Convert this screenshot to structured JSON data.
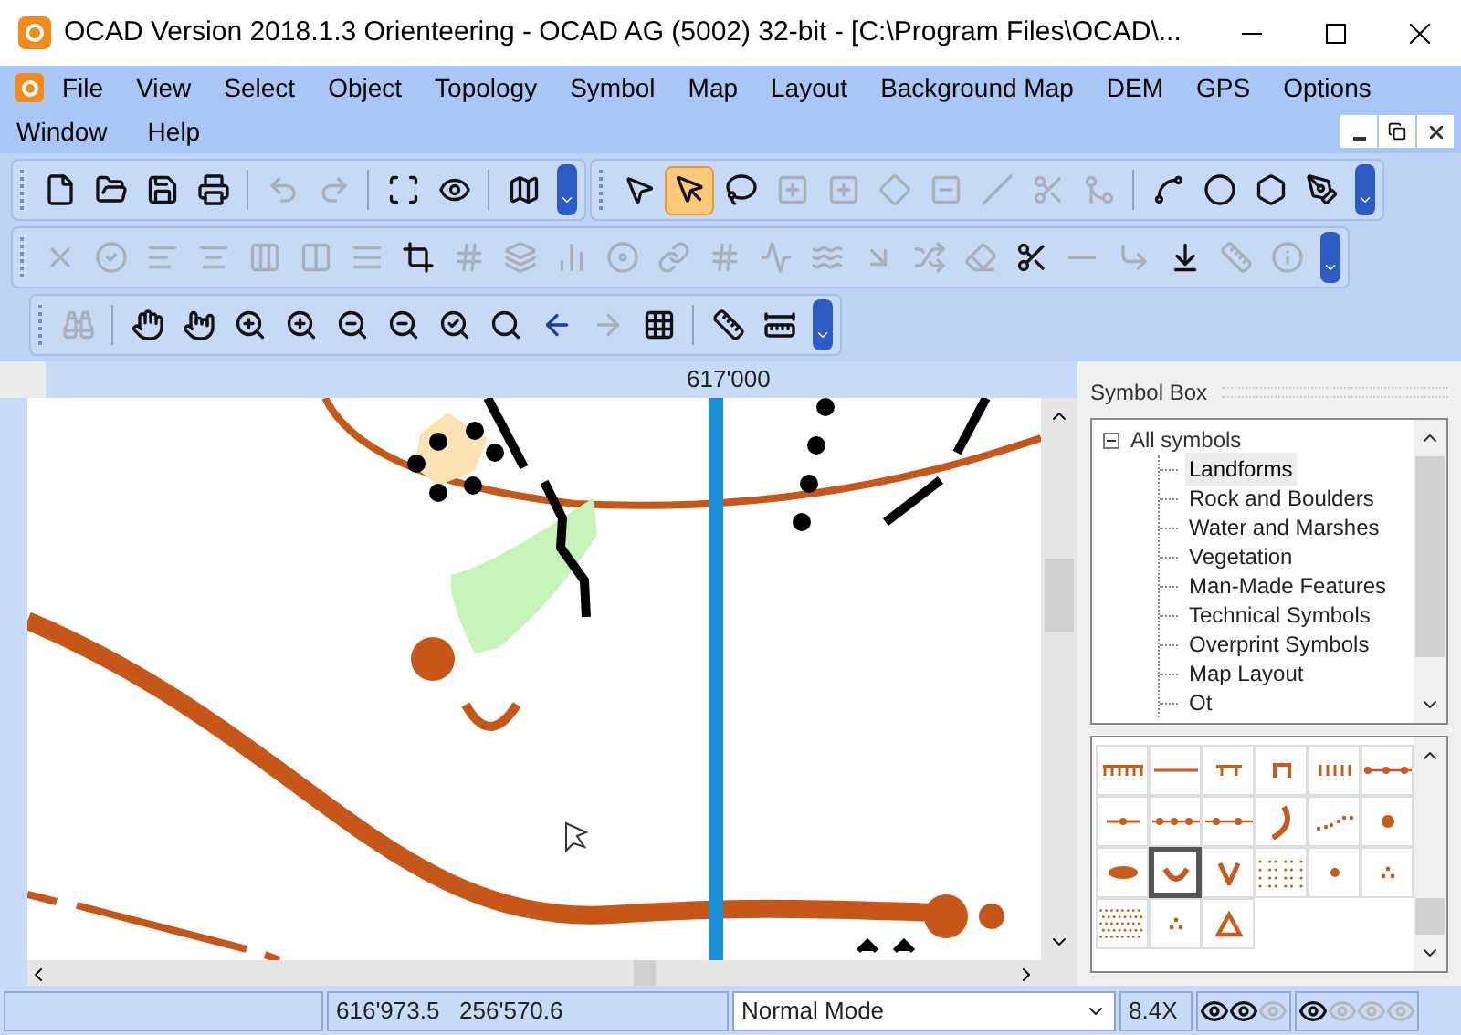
{
  "window": {
    "title": "OCAD Version 2018.1.3  Orienteering - OCAD AG (5002) 32-bit - [C:\\Program Files\\OCAD\\..."
  },
  "menu": [
    {
      "label": "File"
    },
    {
      "label": "View"
    },
    {
      "label": "Select"
    },
    {
      "label": "Object"
    },
    {
      "label": "Topology"
    },
    {
      "label": "Symbol"
    },
    {
      "label": "Map"
    },
    {
      "label": "Layout"
    },
    {
      "label": "Background Map"
    },
    {
      "label": "DEM"
    },
    {
      "label": "GPS"
    },
    {
      "label": "Options"
    },
    {
      "label": "Window"
    },
    {
      "label": "Help"
    }
  ],
  "toolbars": [
    {
      "groups": [
        [
          {
            "disabled": false,
            "selected": false
          },
          {
            "disabled": false,
            "selected": false
          },
          {
            "disabled": false,
            "selected": false
          },
          {
            "disabled": false,
            "selected": false
          }
        ],
        [
          {
            "disabled": true,
            "selected": false
          },
          {
            "disabled": true,
            "selected": false
          }
        ],
        [
          {
            "disabled": false,
            "selected": false
          },
          {
            "disabled": false,
            "selected": false
          }
        ],
        [
          {
            "disabled": false,
            "selected": false
          }
        ]
      ]
    },
    {
      "groups": [
        [
          {
            "disabled": false,
            "selected": false
          },
          {
            "disabled": false,
            "selected": true
          },
          {
            "disabled": false,
            "selected": false
          },
          {
            "disabled": true,
            "selected": false
          },
          {
            "disabled": true,
            "selected": false
          },
          {
            "disabled": true,
            "selected": false
          },
          {
            "disabled": true,
            "selected": false
          },
          {
            "disabled": true,
            "selected": false
          },
          {
            "disabled": true,
            "selected": false
          },
          {
            "disabled": true,
            "selected": false
          }
        ],
        [
          {
            "disabled": false,
            "selected": false
          },
          {
            "disabled": false,
            "selected": false
          },
          {
            "disabled": false,
            "selected": false
          },
          {
            "disabled": false,
            "selected": false
          }
        ]
      ]
    },
    {
      "groups": [
        [
          {
            "disabled": true,
            "selected": false
          },
          {
            "disabled": true,
            "selected": false
          },
          {
            "disabled": true,
            "selected": false
          },
          {
            "disabled": true,
            "selected": false
          },
          {
            "disabled": true,
            "selected": false
          },
          {
            "disabled": true,
            "selected": false
          },
          {
            "disabled": true,
            "selected": false
          },
          {
            "disabled": false,
            "selected": false
          },
          {
            "disabled": true,
            "selected": false
          },
          {
            "disabled": true,
            "selected": false
          },
          {
            "disabled": true,
            "selected": false
          },
          {
            "disabled": true,
            "selected": false
          },
          {
            "disabled": true,
            "selected": false
          },
          {
            "disabled": true,
            "selected": false
          },
          {
            "disabled": true,
            "selected": false
          },
          {
            "disabled": true,
            "selected": false
          },
          {
            "disabled": true,
            "selected": false
          },
          {
            "disabled": true,
            "selected": false
          },
          {
            "disabled": true,
            "selected": false
          },
          {
            "disabled": false,
            "selected": false
          },
          {
            "disabled": true,
            "selected": false
          },
          {
            "disabled": true,
            "selected": false
          },
          {
            "disabled": false,
            "selected": false
          },
          {
            "disabled": true,
            "selected": false
          },
          {
            "disabled": true,
            "selected": false
          }
        ]
      ]
    },
    {
      "groups": [
        [
          {
            "disabled": true,
            "selected": false
          }
        ],
        [
          {
            "disabled": false,
            "selected": false
          },
          {
            "disabled": false,
            "selected": false
          },
          {
            "disabled": false,
            "selected": false
          },
          {
            "disabled": false,
            "selected": false
          },
          {
            "disabled": false,
            "selected": false
          },
          {
            "disabled": false,
            "selected": false
          },
          {
            "disabled": false,
            "selected": false
          },
          {
            "disabled": false,
            "selected": false
          },
          {
            "disabled": false,
            "selected": false
          },
          {
            "disabled": true,
            "selected": false
          },
          {
            "disabled": false,
            "selected": false
          }
        ],
        [
          {
            "disabled": false,
            "selected": false
          },
          {
            "disabled": false,
            "selected": false
          }
        ]
      ]
    }
  ],
  "ruler": {
    "label": "617'000"
  },
  "symbol_box": {
    "title": "Symbol Box",
    "tree": [
      {
        "label": "All symbols",
        "expanded": true,
        "selected": false,
        "children": [
          {
            "label": "Landforms",
            "selected": true
          },
          {
            "label": "Rock and Boulders",
            "selected": false
          },
          {
            "label": "Water and Marshes",
            "selected": false
          },
          {
            "label": "Vegetation",
            "selected": false
          },
          {
            "label": "Man-Made Features",
            "selected": false
          },
          {
            "label": "Technical Symbols",
            "selected": false
          },
          {
            "label": "Overprint Symbols",
            "selected": false
          },
          {
            "label": "Map Layout",
            "selected": false
          },
          {
            "label": "Ot",
            "selected": false
          }
        ]
      }
    ],
    "symbols": [
      {
        "selected": false
      },
      {
        "selected": false
      },
      {
        "selected": false
      },
      {
        "selected": false
      },
      {
        "selected": false
      },
      {
        "selected": false
      },
      {
        "selected": false
      },
      {
        "selected": false
      },
      {
        "selected": false
      },
      {
        "selected": false
      },
      {
        "selected": false
      },
      {
        "selected": false
      },
      {
        "selected": false
      },
      {
        "selected": true
      },
      {
        "selected": false
      },
      {
        "selected": false
      },
      {
        "selected": false
      },
      {
        "selected": false
      },
      {
        "selected": false
      },
      {
        "selected": false
      },
      {
        "selected": false
      }
    ]
  },
  "status_bar": {
    "coordinates": "616'973.5   256'570.6",
    "mode": "Normal Mode",
    "zoom": "8.4X",
    "layer_eyes": [
      [
        {
          "on": true
        },
        {
          "on": true
        },
        {
          "on": false
        }
      ],
      [
        {
          "on": true
        },
        {
          "on": false
        },
        {
          "on": false
        },
        {
          "on": false
        }
      ]
    ]
  }
}
